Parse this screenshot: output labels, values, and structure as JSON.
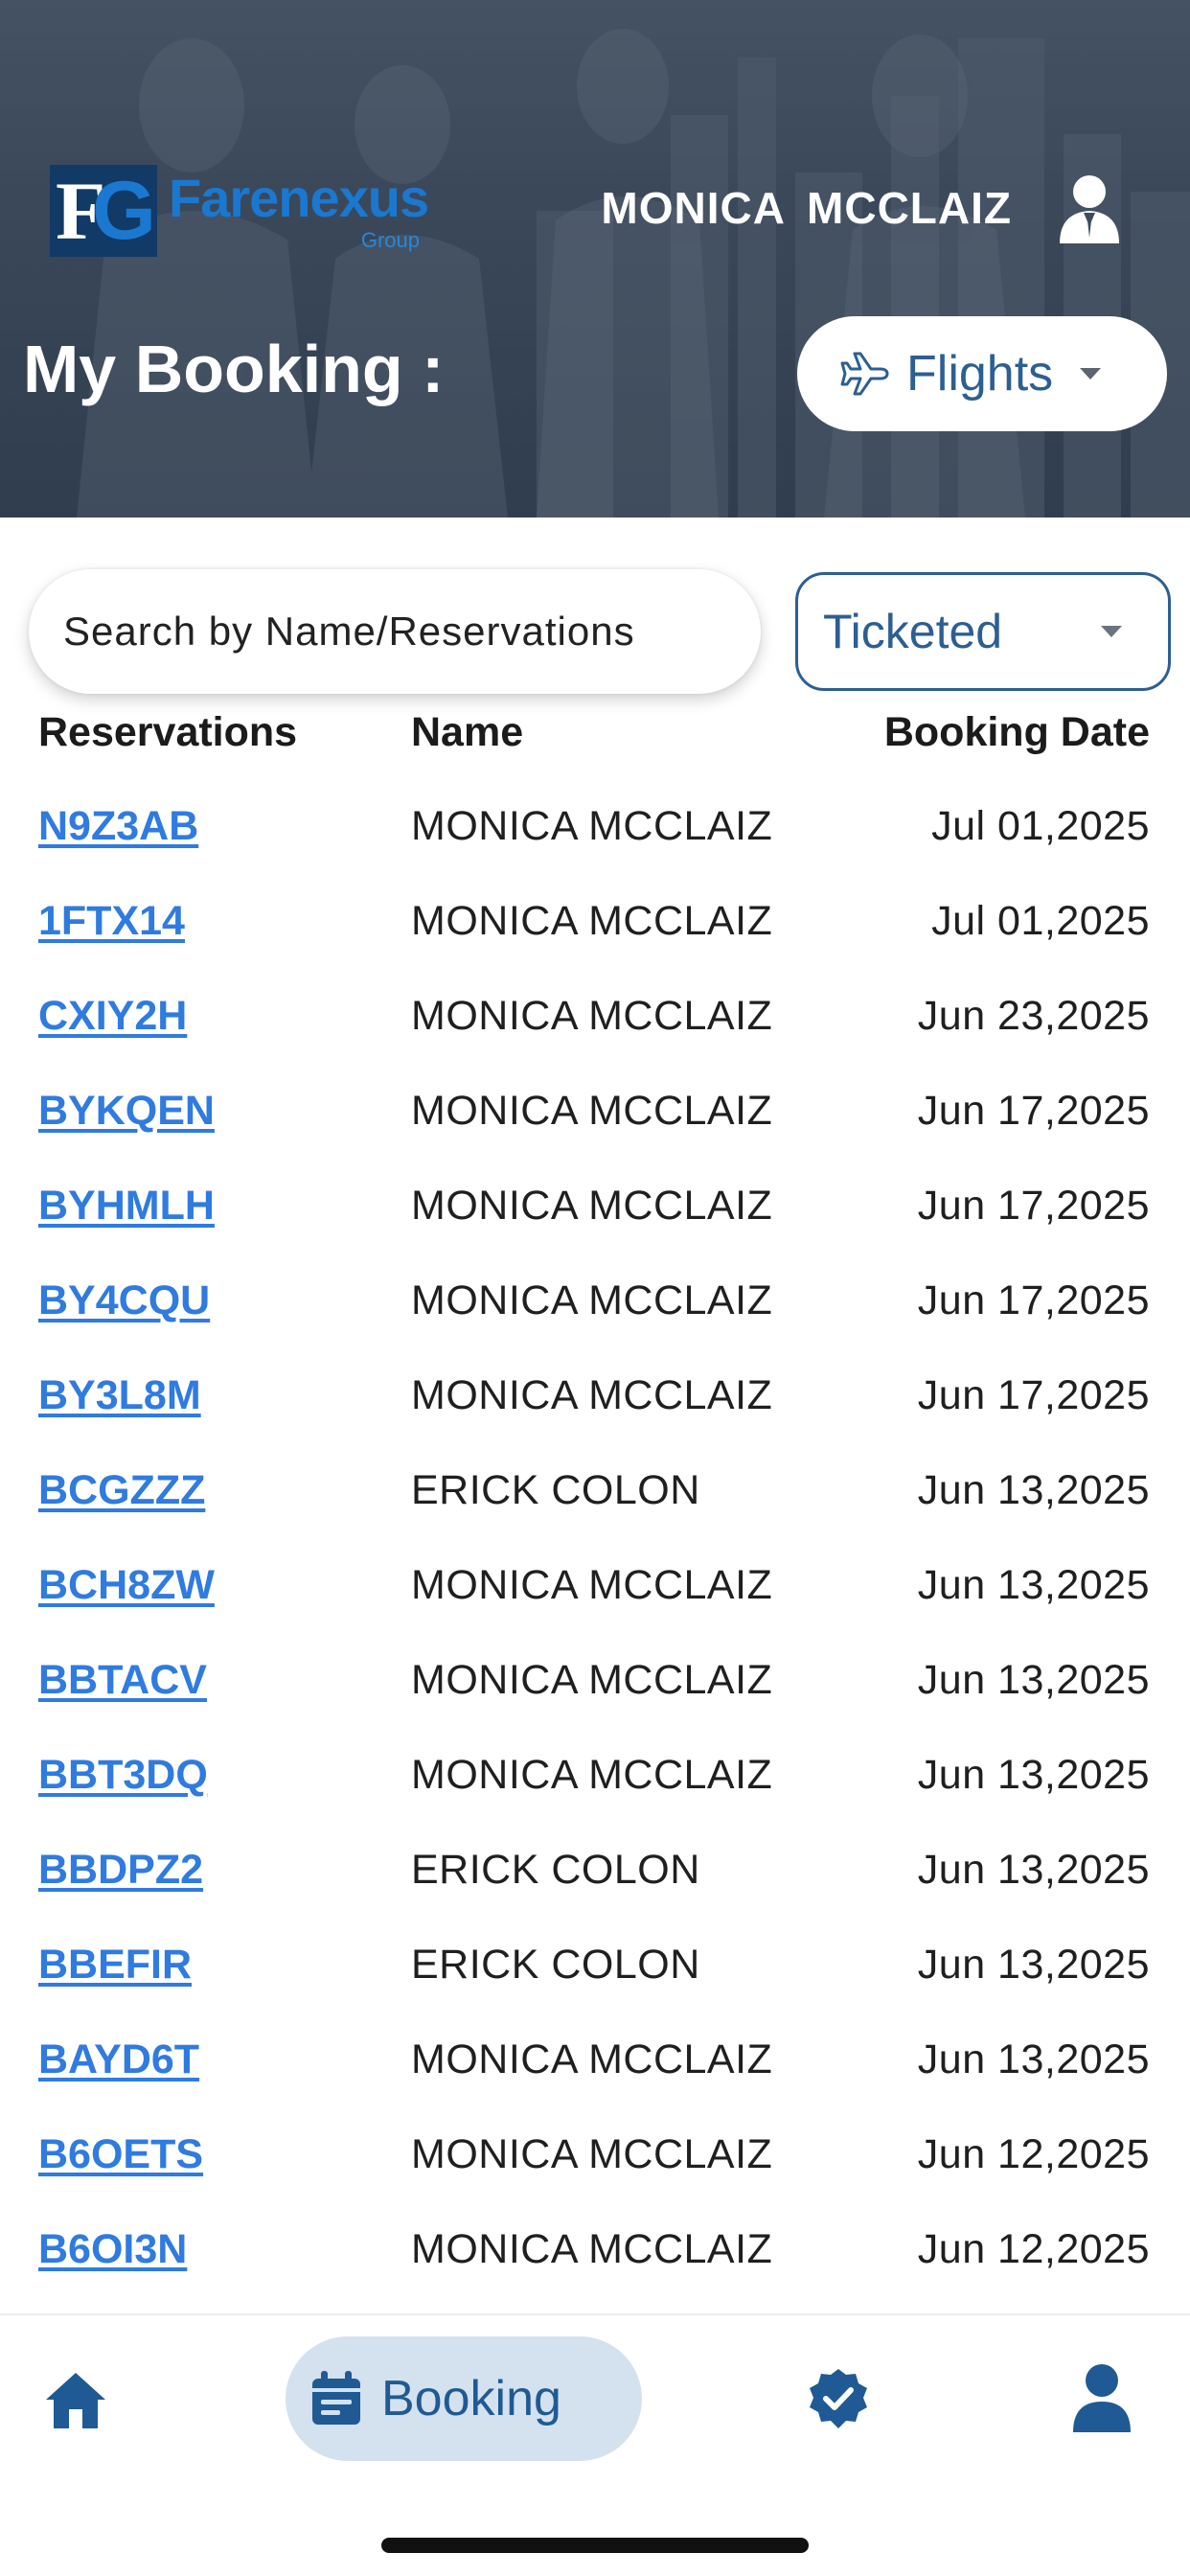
{
  "header": {
    "logo_text": "Farenexus",
    "logo_sub": "Group",
    "logo_mark_f": "F",
    "logo_mark_g": "G",
    "user_name": "MONICA MCCLAIZ",
    "title": "My Booking :",
    "category_selected": "Flights"
  },
  "filters": {
    "search_placeholder": "Search by Name/Reservations",
    "status_selected": "Ticketed"
  },
  "table": {
    "columns": [
      "Reservations",
      "Name",
      "Booking Date"
    ],
    "rows": [
      {
        "reservation": "N9Z3AB",
        "name": "MONICA MCCLAIZ",
        "date": "Jul 01,2025"
      },
      {
        "reservation": "1FTX14",
        "name": "MONICA MCCLAIZ",
        "date": "Jul 01,2025"
      },
      {
        "reservation": "CXIY2H",
        "name": "MONICA MCCLAIZ",
        "date": "Jun 23,2025"
      },
      {
        "reservation": "BYKQEN",
        "name": "MONICA MCCLAIZ",
        "date": "Jun 17,2025"
      },
      {
        "reservation": "BYHMLH",
        "name": "MONICA MCCLAIZ",
        "date": "Jun 17,2025"
      },
      {
        "reservation": "BY4CQU",
        "name": "MONICA MCCLAIZ",
        "date": "Jun 17,2025"
      },
      {
        "reservation": "BY3L8M",
        "name": "MONICA MCCLAIZ",
        "date": "Jun 17,2025"
      },
      {
        "reservation": "BCGZZZ",
        "name": "ERICK COLON",
        "date": "Jun 13,2025"
      },
      {
        "reservation": "BCH8ZW",
        "name": "MONICA MCCLAIZ",
        "date": "Jun 13,2025"
      },
      {
        "reservation": "BBTACV",
        "name": "MONICA MCCLAIZ",
        "date": "Jun 13,2025"
      },
      {
        "reservation": "BBT3DQ",
        "name": "MONICA MCCLAIZ",
        "date": "Jun 13,2025"
      },
      {
        "reservation": "BBDPZ2",
        "name": "ERICK COLON",
        "date": "Jun 13,2025"
      },
      {
        "reservation": "BBEFIR",
        "name": "ERICK COLON",
        "date": "Jun 13,2025"
      },
      {
        "reservation": "BAYD6T",
        "name": "MONICA MCCLAIZ",
        "date": "Jun 13,2025"
      },
      {
        "reservation": "B6OETS",
        "name": "MONICA MCCLAIZ",
        "date": "Jun 12,2025"
      },
      {
        "reservation": "B6OI3N",
        "name": "MONICA MCCLAIZ",
        "date": "Jun 12,2025"
      }
    ]
  },
  "bottom_nav": {
    "items": [
      {
        "icon": "home-icon",
        "label": ""
      },
      {
        "icon": "calendar-icon",
        "label": "Booking",
        "active": true
      },
      {
        "icon": "verified-badge-icon",
        "label": ""
      },
      {
        "icon": "profile-icon",
        "label": ""
      }
    ]
  },
  "colors": {
    "brand_blue": "#2c5f92",
    "link_blue": "#2f7be0",
    "active_pill": "#d4e1ee",
    "header_dark": "#3f4c5e"
  }
}
